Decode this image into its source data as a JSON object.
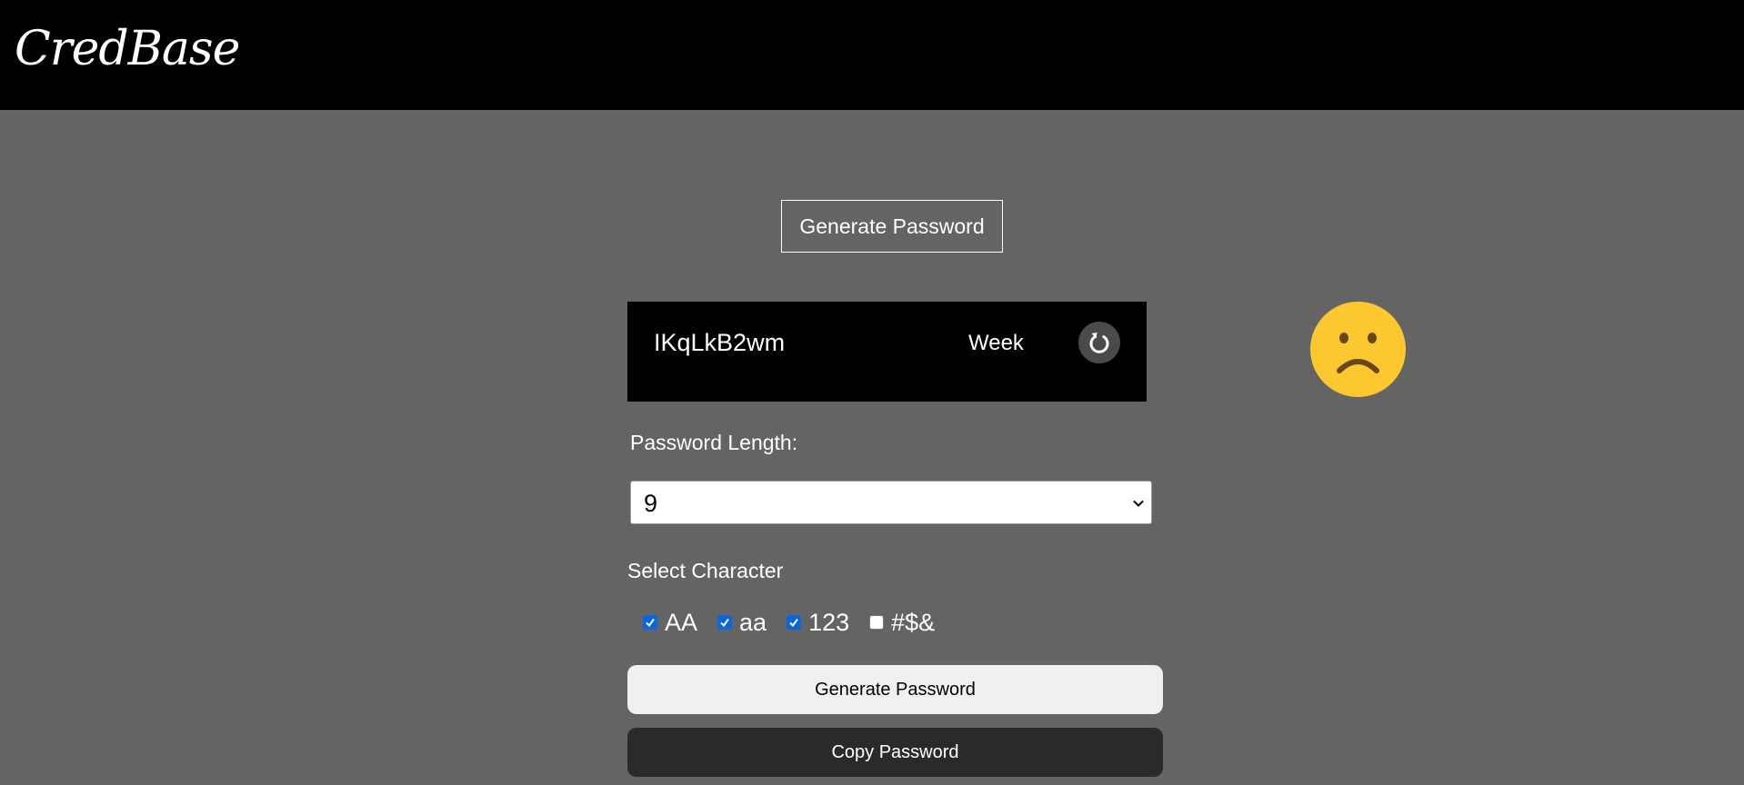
{
  "header": {
    "logo_text": "CredBase",
    "background": "#000000"
  },
  "main": {
    "top_generate_label": "Generate Password",
    "generated_password": "IKqLkB2wm",
    "strength": "Week",
    "strength_icon": "sad-face-icon",
    "refresh_icon": "refresh-icon",
    "length_label": "Password Length:",
    "length_value": "9",
    "charset_label": "Select Character",
    "charsets": [
      {
        "label": "AA",
        "checked": true
      },
      {
        "label": "aa",
        "checked": true
      },
      {
        "label": "123",
        "checked": true
      },
      {
        "label": "#$&",
        "checked": false
      }
    ],
    "generate_label": "Generate Password",
    "copy_label": "Copy Password"
  },
  "colors": {
    "page_background": "#646464",
    "checkbox_accent": "#0a66e0",
    "emoji_yellow": "#fcc72f"
  }
}
